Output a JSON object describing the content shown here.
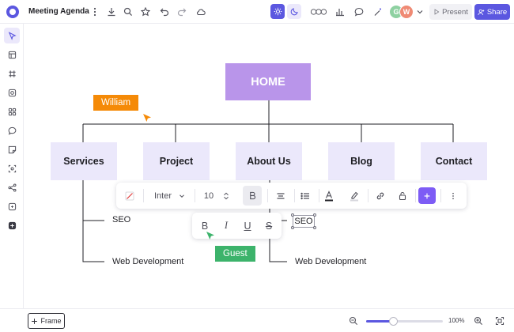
{
  "app": {
    "title": "Meeting Agenda",
    "colors": {
      "accent": "#5b57e0",
      "home_node": "#b995ea",
      "child_node": "#ebe8fb",
      "william_tag": "#f58a07",
      "guest_tag": "#3cb36b"
    }
  },
  "topbar": {
    "icons": [
      "more-vertical-icon",
      "download-icon",
      "search-icon",
      "star-icon",
      "undo-icon",
      "redo-icon",
      "cloud-icon"
    ],
    "right_icons": [
      "sun-icon",
      "moon-icon",
      "reactions-icon",
      "bar-chart-icon",
      "comment-icon",
      "magic-wand-icon"
    ],
    "avatars": [
      {
        "initial": "G",
        "color": "#8ed1a1"
      },
      {
        "initial": "W",
        "color": "#ef8a74"
      }
    ],
    "present_label": "Present",
    "share_label": "Share"
  },
  "sidebar": {
    "items": [
      "pointer-icon",
      "layout-icon",
      "frame-icon",
      "shapes-icon",
      "components-icon",
      "comment-icon",
      "sticky-note-icon",
      "image-icon",
      "connector-icon",
      "embed-icon",
      "plus-icon"
    ]
  },
  "diagram": {
    "root": "HOME",
    "children": [
      "Services",
      "Project",
      "About Us",
      "Blog",
      "Contact"
    ],
    "services_leaves": [
      "SEO",
      "Web Development"
    ],
    "about_leaves": [
      "SEO",
      "Web Development"
    ]
  },
  "cursors": {
    "william": "William",
    "guest": "Guest"
  },
  "toolbar": {
    "font_family": "Inter",
    "font_size": "10",
    "icons": [
      "slash-color-icon",
      "chevron-down-icon",
      "stepper-icon",
      "bold-icon",
      "align-icon",
      "list-icon",
      "text-color-icon",
      "highlight-icon",
      "link-icon",
      "lock-icon",
      "add-icon",
      "more-icon"
    ]
  },
  "format_toolbar": {
    "bold": "B",
    "italic": "I",
    "underline": "U",
    "strike": "S"
  },
  "bottombar": {
    "frame_label": "Frame",
    "zoom_level": "100%",
    "zoom_fraction": 0.35
  }
}
